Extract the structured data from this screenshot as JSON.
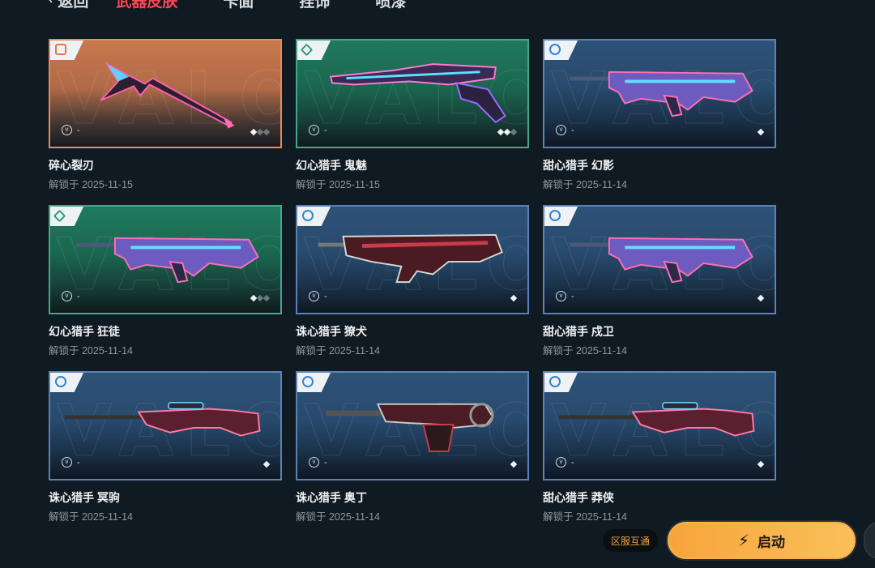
{
  "nav": {
    "back_label": "返回",
    "tabs": [
      "武器皮肤",
      "卡面",
      "挂饰",
      "喷漆"
    ],
    "active_tab": "武器皮肤"
  },
  "items": [
    {
      "name": "碎心裂刃",
      "date": "解锁于 2025-11-15",
      "meta": "-",
      "tier": "orange",
      "dots": [
        true,
        false,
        false
      ],
      "weapon": "melee-icon"
    },
    {
      "name": "幻心猎手 鬼魅",
      "date": "解锁于 2025-11-15",
      "meta": "-",
      "tier": "green",
      "dots": [
        true,
        true,
        false
      ],
      "weapon": "pistol-icon"
    },
    {
      "name": "甜心猎手 幻影",
      "date": "解锁于 2025-11-14",
      "meta": "-",
      "tier": "blue",
      "dots": [
        true
      ],
      "weapon": "rifle-icon"
    },
    {
      "name": "幻心猎手 狂徒",
      "date": "解锁于 2025-11-14",
      "meta": "-",
      "tier": "green",
      "dots": [
        true,
        false,
        false
      ],
      "weapon": "rifle-icon"
    },
    {
      "name": "诛心猎手 獠犬",
      "date": "解锁于 2025-11-14",
      "meta": "-",
      "tier": "blue",
      "dots": [
        true
      ],
      "weapon": "smg-icon"
    },
    {
      "name": "甜心猎手 戍卫",
      "date": "解锁于 2025-11-14",
      "meta": "-",
      "tier": "blue",
      "dots": [
        true
      ],
      "weapon": "rifle-icon"
    },
    {
      "name": "诛心猎手 冥驹",
      "date": "解锁于 2025-11-14",
      "meta": "-",
      "tier": "blue",
      "dots": [
        true
      ],
      "weapon": "sniper-icon"
    },
    {
      "name": "诛心猎手 奥丁",
      "date": "解锁于 2025-11-14",
      "meta": "-",
      "tier": "blue",
      "dots": [
        true
      ],
      "weapon": "machinegun-icon"
    },
    {
      "name": "甜心猎手 莽侠",
      "date": "解锁于 2025-11-14",
      "meta": "-",
      "tier": "blue",
      "dots": [
        true
      ],
      "weapon": "sniper-icon"
    }
  ],
  "footer": {
    "cross_server": "区服互通",
    "launch_label": "启动"
  },
  "colors": {
    "accent_red": "#ff4655",
    "launch_orange": "#f7a43a",
    "tier_orange": "#e88a5c",
    "tier_green": "#43a88a",
    "tier_blue": "#5b82b4"
  }
}
